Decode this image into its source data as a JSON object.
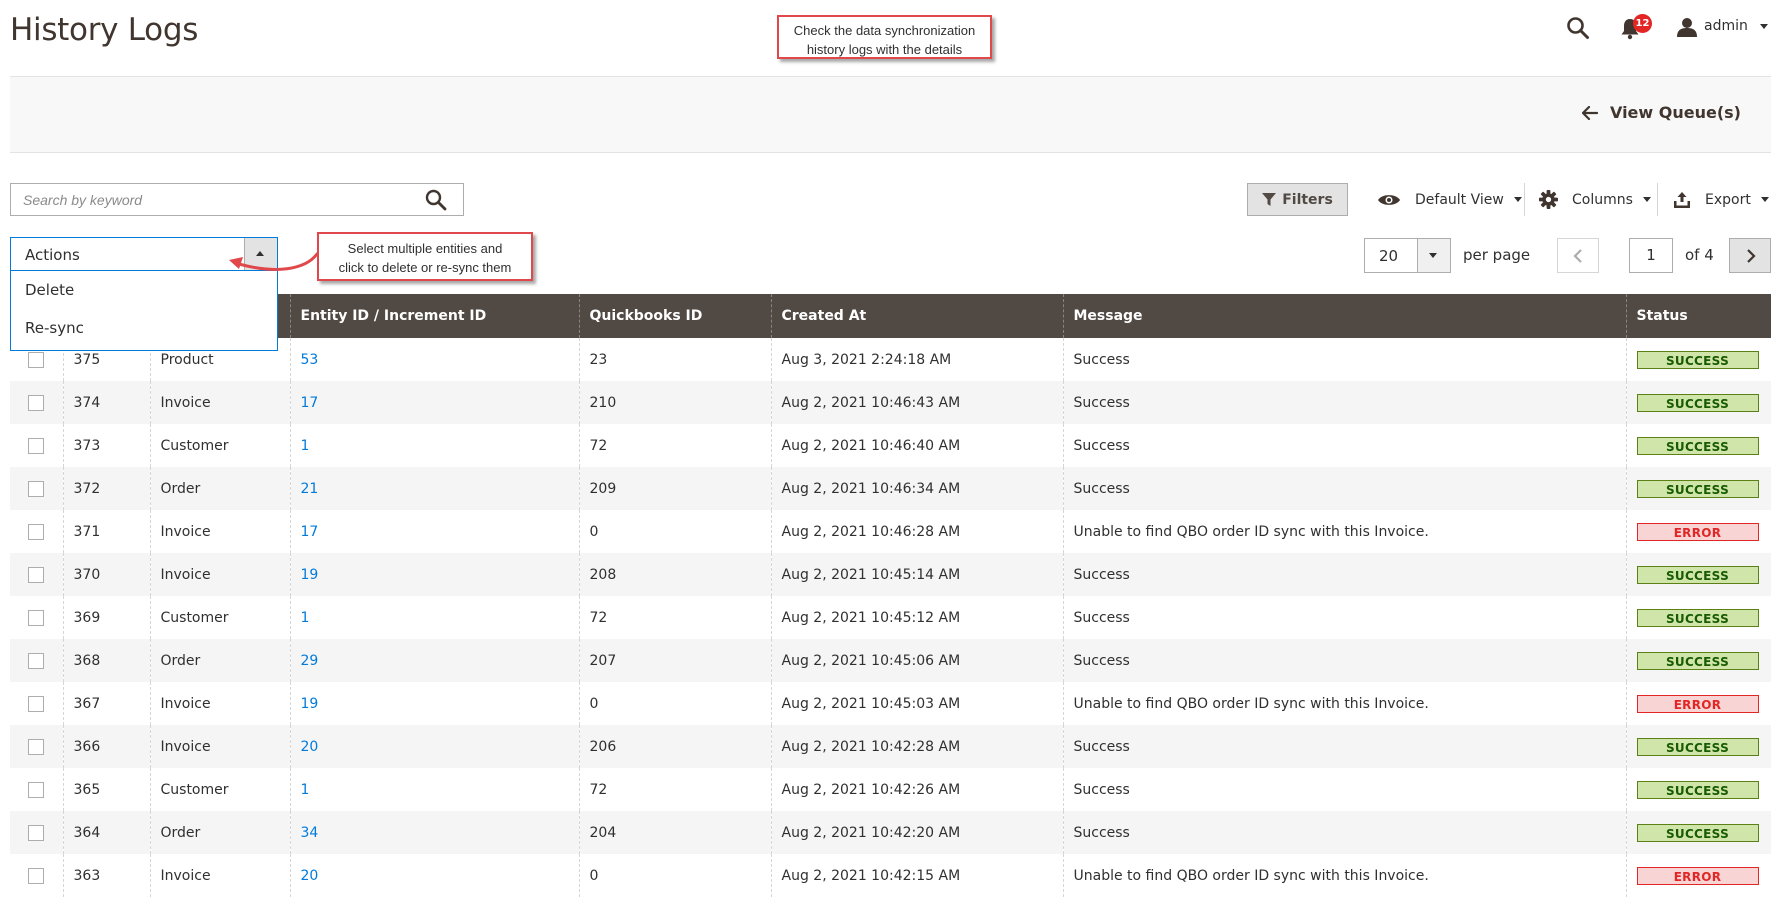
{
  "page": {
    "title": "History Logs"
  },
  "callouts": {
    "top": {
      "line1": "Check the data synchronization",
      "line2": "history logs with the details"
    },
    "actions": {
      "line1": "Select multiple entities and",
      "line2": "click to delete or re-sync them"
    }
  },
  "header": {
    "notification_count": "12",
    "user": "admin",
    "icons": [
      "search-icon",
      "bell-icon",
      "user-icon"
    ]
  },
  "page_actions": {
    "back_label": "View Queue(s)"
  },
  "toolbar": {
    "search_placeholder": "Search by keyword",
    "filters_label": "Filters",
    "view_label": "Default View",
    "columns_label": "Columns",
    "export_label": "Export"
  },
  "mass_actions": {
    "label": "Actions",
    "options": [
      "Delete",
      "Re-sync"
    ]
  },
  "pager": {
    "per_page_value": "20",
    "per_page_label": "per page",
    "current_page": "1",
    "of_label": "of 4"
  },
  "grid": {
    "headers": [
      "",
      "",
      "",
      "Entity ID / Increment ID",
      "Quickbooks ID",
      "Created At",
      "Message",
      "Status"
    ],
    "rows": [
      {
        "id": "375",
        "type": "Product",
        "entity": "53",
        "qb": "23",
        "created": "Aug 3, 2021 2:24:18 AM",
        "message": "Success",
        "status": "SUCCESS"
      },
      {
        "id": "374",
        "type": "Invoice",
        "entity": "17",
        "qb": "210",
        "created": "Aug 2, 2021 10:46:43 AM",
        "message": "Success",
        "status": "SUCCESS"
      },
      {
        "id": "373",
        "type": "Customer",
        "entity": "1",
        "qb": "72",
        "created": "Aug 2, 2021 10:46:40 AM",
        "message": "Success",
        "status": "SUCCESS"
      },
      {
        "id": "372",
        "type": "Order",
        "entity": "21",
        "qb": "209",
        "created": "Aug 2, 2021 10:46:34 AM",
        "message": "Success",
        "status": "SUCCESS"
      },
      {
        "id": "371",
        "type": "Invoice",
        "entity": "17",
        "qb": "0",
        "created": "Aug 2, 2021 10:46:28 AM",
        "message": "Unable to find QBO order ID sync with this Invoice.",
        "status": "ERROR"
      },
      {
        "id": "370",
        "type": "Invoice",
        "entity": "19",
        "qb": "208",
        "created": "Aug 2, 2021 10:45:14 AM",
        "message": "Success",
        "status": "SUCCESS"
      },
      {
        "id": "369",
        "type": "Customer",
        "entity": "1",
        "qb": "72",
        "created": "Aug 2, 2021 10:45:12 AM",
        "message": "Success",
        "status": "SUCCESS"
      },
      {
        "id": "368",
        "type": "Order",
        "entity": "29",
        "qb": "207",
        "created": "Aug 2, 2021 10:45:06 AM",
        "message": "Success",
        "status": "SUCCESS"
      },
      {
        "id": "367",
        "type": "Invoice",
        "entity": "19",
        "qb": "0",
        "created": "Aug 2, 2021 10:45:03 AM",
        "message": "Unable to find QBO order ID sync with this Invoice.",
        "status": "ERROR"
      },
      {
        "id": "366",
        "type": "Invoice",
        "entity": "20",
        "qb": "206",
        "created": "Aug 2, 2021 10:42:28 AM",
        "message": "Success",
        "status": "SUCCESS"
      },
      {
        "id": "365",
        "type": "Customer",
        "entity": "1",
        "qb": "72",
        "created": "Aug 2, 2021 10:42:26 AM",
        "message": "Success",
        "status": "SUCCESS"
      },
      {
        "id": "364",
        "type": "Order",
        "entity": "34",
        "qb": "204",
        "created": "Aug 2, 2021 10:42:20 AM",
        "message": "Success",
        "status": "SUCCESS"
      },
      {
        "id": "363",
        "type": "Invoice",
        "entity": "20",
        "qb": "0",
        "created": "Aug 2, 2021 10:42:15 AM",
        "message": "Unable to find QBO order ID sync with this Invoice.",
        "status": "ERROR"
      }
    ]
  },
  "colors": {
    "header_bg": "#514943",
    "link": "#007bdb",
    "callout_border": "#e0484b",
    "success_bg": "#d0e5a9",
    "error_bg": "#f9d4d4"
  }
}
